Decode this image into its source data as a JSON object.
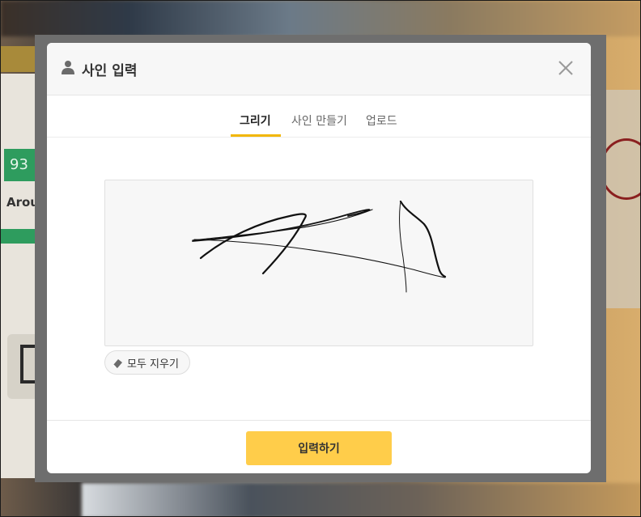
{
  "background": {
    "green_text": "93",
    "label": "Arou"
  },
  "modal": {
    "title": "사인 입력",
    "title_icon": "person-icon",
    "close_icon": "close-icon"
  },
  "tabs": [
    {
      "label": "그리기",
      "active": true
    },
    {
      "label": "사인 만들기",
      "active": false
    },
    {
      "label": "업로드",
      "active": false
    }
  ],
  "colors": {
    "accent": "#f2b705",
    "submit_bg": "#ffcd4a"
  },
  "signature_pad": {
    "clear_label": "모두 지우기",
    "clear_icon": "eraser-icon"
  },
  "footer": {
    "submit_label": "입력하기"
  }
}
